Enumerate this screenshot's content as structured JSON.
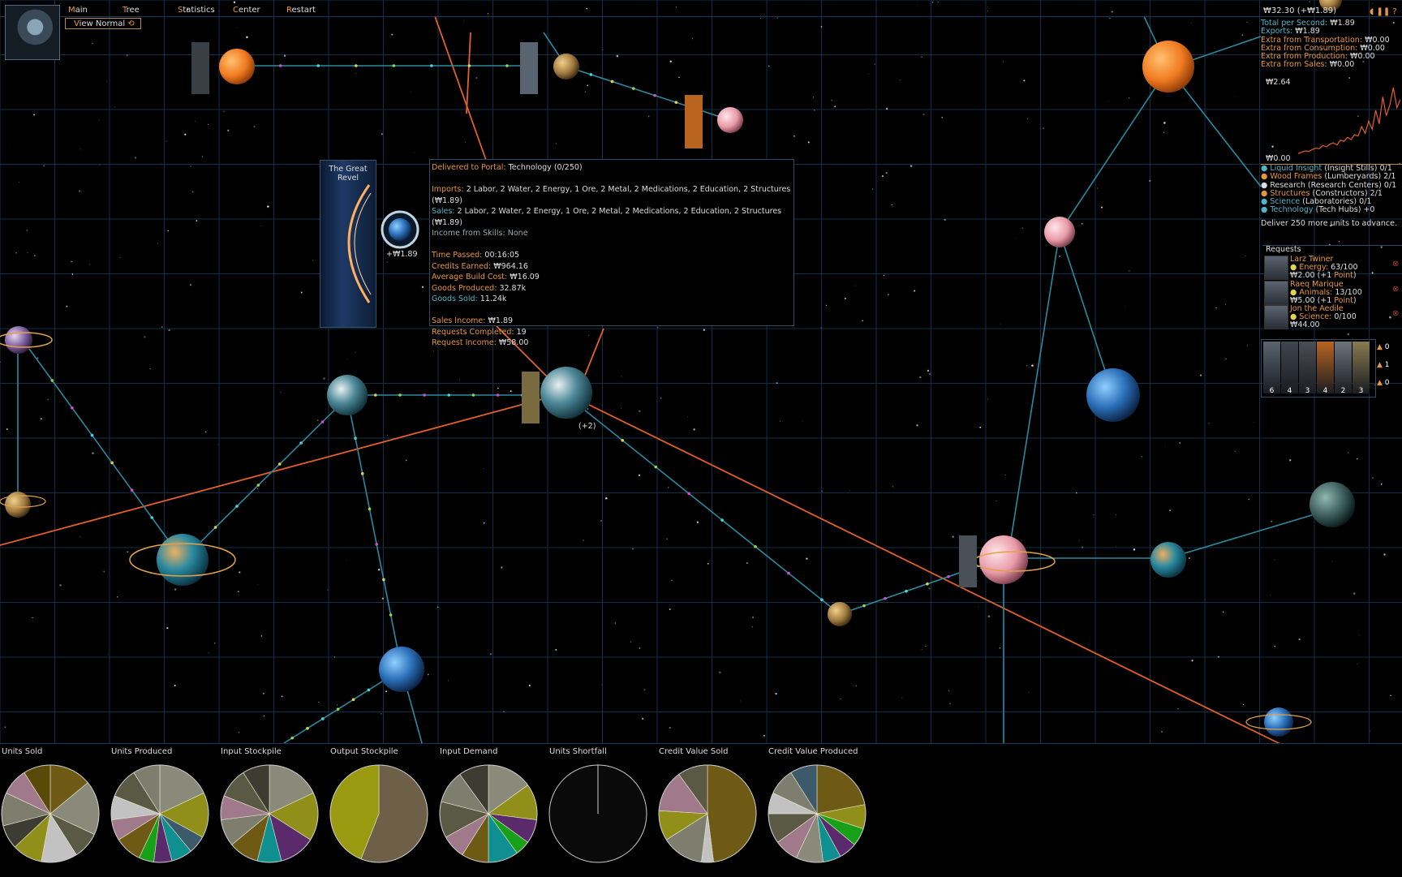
{
  "menu": {
    "main": {
      "hotkey": "M",
      "rest": "ain"
    },
    "tree": {
      "hotkey": "T",
      "rest": "ree"
    },
    "statistics": {
      "hotkey": "S",
      "rest": "tatistics"
    },
    "center": {
      "hotkey": "C",
      "rest": "enter"
    },
    "restart": {
      "hotkey": "R",
      "rest": "estart"
    }
  },
  "view": {
    "hotkey": "V",
    "rest": "iew",
    "value": "Normal"
  },
  "portal_card": {
    "title": "The Great Revel"
  },
  "portal_income": "+₩1.89",
  "hub_count": "(+2)",
  "tooltip": {
    "delivered_label": "Delivered to Portal:",
    "delivered_value": "Technology (0/250)",
    "imports_label": "Imports:",
    "imports_value": "2 Labor, 2 Water, 2 Energy, 1 Ore, 2 Metal, 2 Medications, 2 Education, 2 Structures (₩1.89)",
    "sales_label": "Sales:",
    "sales_value": "2 Labor, 2 Water, 2 Energy, 1 Ore, 2 Metal, 2 Medications, 2 Education, 2 Structures (₩1.89)",
    "skills_label": "Income from Skills:",
    "skills_value": "None",
    "time_label": "Time Passed:",
    "time_value": "00:16:05",
    "credits_label": "Credits Earned:",
    "credits_value": "₩964.16",
    "build_label": "Average Build Cost:",
    "build_value": "₩16.09",
    "produced_label": "Goods Produced:",
    "produced_value": "32.87k",
    "sold_label": "Goods Sold:",
    "sold_value": "11.24k",
    "sales_income_label": "Sales Income:",
    "sales_income_value": "₩1.89",
    "requests_label": "Requests Completed:",
    "requests_value": "19",
    "request_income_label": "Request Income:",
    "request_income_value": "₩58.00"
  },
  "income": {
    "top": "₩32.30 (+₩1.89)",
    "total_label": "Total per Second:",
    "total_value": "₩1.89",
    "exports_label": "Exports:",
    "exports_value": "₩1.89",
    "transport_label": "Extra from Transportation:",
    "transport_value": "₩0.00",
    "consumption_label": "Extra from Consumption:",
    "consumption_value": "₩0.00",
    "production_label": "Extra from Production:",
    "production_value": "₩0.00",
    "salesx_label": "Extra from Sales:",
    "salesx_value": "₩0.00",
    "graph_max": "₩2.64",
    "graph_min": "₩0.00",
    "graph_values": [
      0.2,
      0.25,
      0.3,
      0.28,
      0.35,
      0.4,
      0.38,
      0.5,
      0.45,
      0.55,
      0.6,
      0.52,
      0.7,
      0.65,
      0.8,
      0.72,
      0.9,
      0.85,
      1.2,
      0.95,
      1.4,
      1.1,
      1.8,
      1.3,
      2.3,
      1.6,
      2.0,
      2.64,
      1.9,
      2.2
    ]
  },
  "goals": [
    {
      "name": "Liquid Insight",
      "rest": " (Insight Stills) 0/1"
    },
    {
      "name": "Wood Frames",
      "rest": " (Lumberyards) 2/1"
    },
    {
      "name": "Research",
      "rest": " (Research Centers) 0/1"
    },
    {
      "name": "Structures",
      "rest": " (Constructors) 2/1"
    },
    {
      "name": "Science",
      "rest": " (Laboratories) 0/1"
    },
    {
      "name": "Technology",
      "rest": " (Tech Hubs) +0"
    }
  ],
  "advance_text": "Deliver 250 more units to advance.",
  "requests": {
    "title": "Requests",
    "items": [
      {
        "person": "Larz Twiner",
        "resource": "Energy:",
        "amount": "63/100",
        "reward": "₩2.00 (+1 ",
        "point": "Point",
        "close": ")"
      },
      {
        "person": "Raeq Marique",
        "resource": "Animals:",
        "amount": "13/100",
        "reward": "₩5.00 (+1 ",
        "point": "Point",
        "close": ")"
      },
      {
        "person": "Jon the Aedile",
        "resource": "Science:",
        "amount": "0/100",
        "reward": "₩44.00",
        "point": "",
        "close": ""
      }
    ]
  },
  "crew": {
    "counts": [
      "6",
      "4",
      "3",
      "4",
      "2",
      "3"
    ],
    "badges": [
      "0",
      "1",
      "0"
    ]
  },
  "pies": [
    {
      "label": "Units Sold",
      "colors": [
        "#6e5a14",
        "#8a8a7a",
        "#5a5a44",
        "#c2c2c2",
        "#8f8f19",
        "#3c3c32",
        "#7e7e6e",
        "#a07a8a",
        "#5a4a0a"
      ],
      "values": [
        14,
        18,
        9,
        12,
        10,
        8,
        11,
        9,
        9
      ]
    },
    {
      "label": "Units Produced",
      "colors": [
        "#8a8a7a",
        "#8f8f19",
        "#3c5a6a",
        "#0f8f8f",
        "#5a2a6a",
        "#19a019",
        "#6e5a14",
        "#a07a8a",
        "#c2c2c2",
        "#5a5a44",
        "#7e7e6e"
      ],
      "values": [
        18,
        15,
        6,
        7,
        6,
        5,
        9,
        7,
        8,
        10,
        9
      ]
    },
    {
      "label": "Input Stockpile",
      "colors": [
        "#8a8a7a",
        "#8f8f19",
        "#5a2a6a",
        "#0f8f8f",
        "#6e5a14",
        "#7e7e6e",
        "#a07a8a",
        "#5a5a44",
        "#3c3c32"
      ],
      "values": [
        18,
        16,
        12,
        8,
        10,
        9,
        8,
        10,
        9
      ]
    },
    {
      "label": "Output Stockpile",
      "colors": [
        "#6e6048",
        "#9a9a10"
      ],
      "values": [
        56,
        44
      ]
    },
    {
      "label": "Input Demand",
      "colors": [
        "#8a8a7a",
        "#8f8f19",
        "#5a2a6a",
        "#19a019",
        "#0f8f8f",
        "#6e5a14",
        "#a07a8a",
        "#5a5a44",
        "#7e7e6e",
        "#3c3c32"
      ],
      "values": [
        15,
        12,
        8,
        5,
        10,
        9,
        8,
        12,
        11,
        10
      ]
    },
    {
      "label": "Units Shortfall",
      "colors": [
        "#0a0a0a"
      ],
      "values": [
        100
      ]
    },
    {
      "label": "Credit Value Sold",
      "colors": [
        "#6e5a14",
        "#c2c2c2",
        "#7e7e6e",
        "#8f8f19",
        "#a07a8a",
        "#5a5a44"
      ],
      "values": [
        48,
        4,
        14,
        10,
        14,
        10
      ]
    },
    {
      "label": "Credit Value Produced",
      "colors": [
        "#6e5a14",
        "#8f8f19",
        "#19a019",
        "#5a2a6a",
        "#0f8f8f",
        "#8a8a7a",
        "#a07a8a",
        "#5a5a44",
        "#c2c2c2",
        "#7e7e6e",
        "#3c5a6a"
      ],
      "values": [
        22,
        8,
        6,
        6,
        6,
        9,
        8,
        10,
        7,
        9,
        9
      ]
    }
  ],
  "colors": {
    "accent": "#e8963a",
    "teal": "#4fb6c9",
    "grid": "#12304a",
    "route": "#2a8aa0",
    "orange_route": "#e2602a"
  }
}
